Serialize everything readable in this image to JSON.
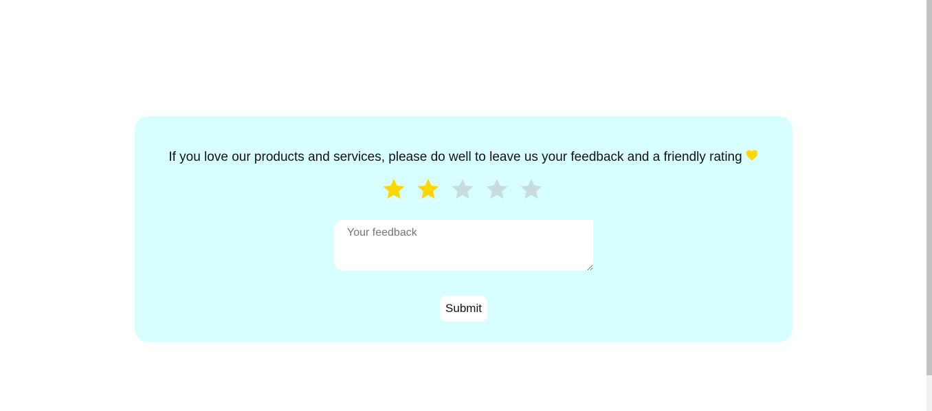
{
  "feedback_card": {
    "prompt_text": "If you love our products and services, please do well to leave us your feedback and a friendly rating",
    "heart_icon": "yellow-heart-icon",
    "rating": {
      "value": 2,
      "max": 5,
      "filled_color": "#FFD700",
      "empty_color": "#C8DCDC"
    },
    "feedback_input": {
      "placeholder": "Your feedback",
      "value": ""
    },
    "submit_label": "Submit"
  },
  "colors": {
    "card_background": "#D7FFFF",
    "page_background": "#FFFFFF",
    "heart": "#FFD700"
  }
}
